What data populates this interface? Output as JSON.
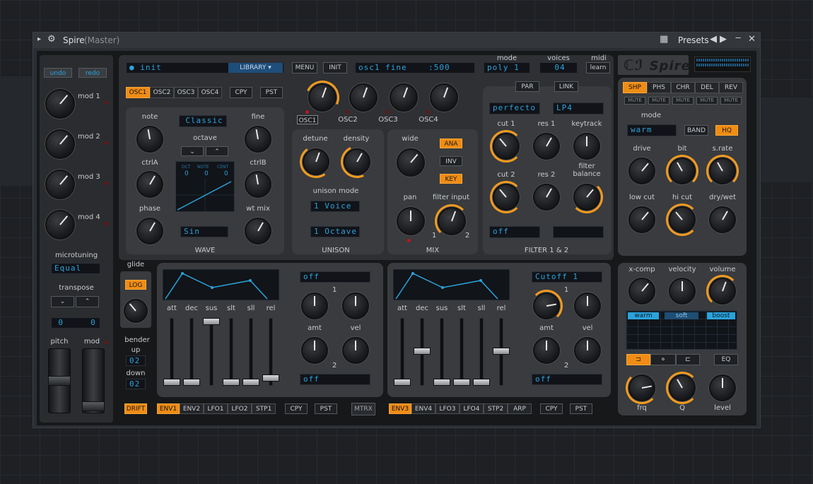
{
  "host": {
    "title": "Spire",
    "title_suffix": "(Master)",
    "presets_label": "Presets"
  },
  "left": {
    "undo": "undo",
    "redo": "redo",
    "mods": [
      "mod 1",
      "mod 2",
      "mod 3",
      "mod 4"
    ],
    "microtuning_label": "microtuning",
    "microtuning_value": "Equal",
    "transpose_label": "transpose",
    "transpose_values": [
      "0",
      "0"
    ],
    "glide_label": "glide",
    "log_label": "LOG",
    "pitch_label": "pitch",
    "mod_label": "mod",
    "bender_label": "bender",
    "up_label": "up",
    "up_value": "02",
    "down_label": "down",
    "down_value": "02"
  },
  "top": {
    "patch_name": "init",
    "library": "LIBRARY",
    "menu": "MENU",
    "init": "INIT",
    "param_display": "osc1 fine    :500",
    "mode_label": "mode",
    "mode_value": "poly 1",
    "voices_label": "voices",
    "voices_value": "04",
    "midi_label": "midi",
    "midi_value": "learn",
    "logo": "Spire"
  },
  "osc": {
    "tabs": [
      "OSC1",
      "OSC2",
      "OSC3",
      "OSC4"
    ],
    "copy": "CPY",
    "paste": "PST",
    "mix_labels": [
      "OSC1",
      "OSC2",
      "OSC3",
      "OSC4"
    ],
    "note": "note",
    "fine": "fine",
    "wavetype": "Classic",
    "octave": "octave",
    "ctrlA": "ctrlA",
    "ctrlB": "ctrlB",
    "oct_hdr": [
      "OCT",
      "NOTE",
      "CENT"
    ],
    "oct_vals": [
      "0",
      "0",
      "0"
    ],
    "phase": "phase",
    "wtmix": "wt mix",
    "wave_value": "Sin",
    "wave_title": "WAVE"
  },
  "unison": {
    "detune": "detune",
    "density": "density",
    "mode_label": "unison mode",
    "voice": "1 Voice",
    "octave": "1 Octave",
    "title": "UNISON"
  },
  "mix": {
    "wide": "wide",
    "ana": "ANA",
    "inv": "INV",
    "key": "KEY",
    "pan": "pan",
    "filter_input": "filter input",
    "fi_1": "1",
    "fi_2": "2",
    "title": "MIX"
  },
  "filter": {
    "par": "PAR",
    "link": "LINK",
    "f1_type": "perfecto",
    "f1_mode": "LP4",
    "cut1": "cut 1",
    "res1": "res 1",
    "keytrack": "keytrack",
    "cut2": "cut 2",
    "res2": "res 2",
    "balance": "filter\nbalance",
    "f2_type": "off",
    "title": "FILTER 1 & 2"
  },
  "fx": {
    "tabs": [
      "SHP",
      "PHS",
      "CHR",
      "DEL",
      "REV"
    ],
    "mute": "MUTE",
    "mode_label": "mode",
    "mode_value": "warm",
    "band": "BAND",
    "hq": "HQ",
    "drive": "drive",
    "bit": "bit",
    "srate": "s.rate",
    "lowcut": "low cut",
    "hicut": "hi cut",
    "drywet": "dry/wet"
  },
  "master": {
    "xcomp": "x-comp",
    "velocity": "velocity",
    "volume": "volume",
    "eq_modes": [
      "warm",
      "soft",
      "boost"
    ],
    "eq": "EQ",
    "frq": "frq",
    "q": "Q",
    "level": "level"
  },
  "env_left": {
    "labels": [
      "att",
      "dec",
      "sus",
      "slt",
      "sll",
      "rel"
    ],
    "dest1": "off",
    "amt": "amt",
    "vel": "vel",
    "n1": "1",
    "n2": "2",
    "dest2": "off",
    "tabs": [
      "ENV1",
      "ENV2",
      "LFO1",
      "LFO2",
      "STP1"
    ],
    "drift": "DRIFT",
    "copy": "CPY",
    "paste": "PST",
    "mtrx": "MTRX"
  },
  "env_right": {
    "labels": [
      "att",
      "dec",
      "sus",
      "slt",
      "sll",
      "rel"
    ],
    "dest1": "Cutoff 1",
    "amt": "amt",
    "vel": "vel",
    "n1": "1",
    "n2": "2",
    "dest2": "off",
    "tabs": [
      "ENV3",
      "ENV4",
      "LFO3",
      "LFO4",
      "STP2",
      "ARP"
    ],
    "copy": "CPY",
    "paste": "PST"
  }
}
